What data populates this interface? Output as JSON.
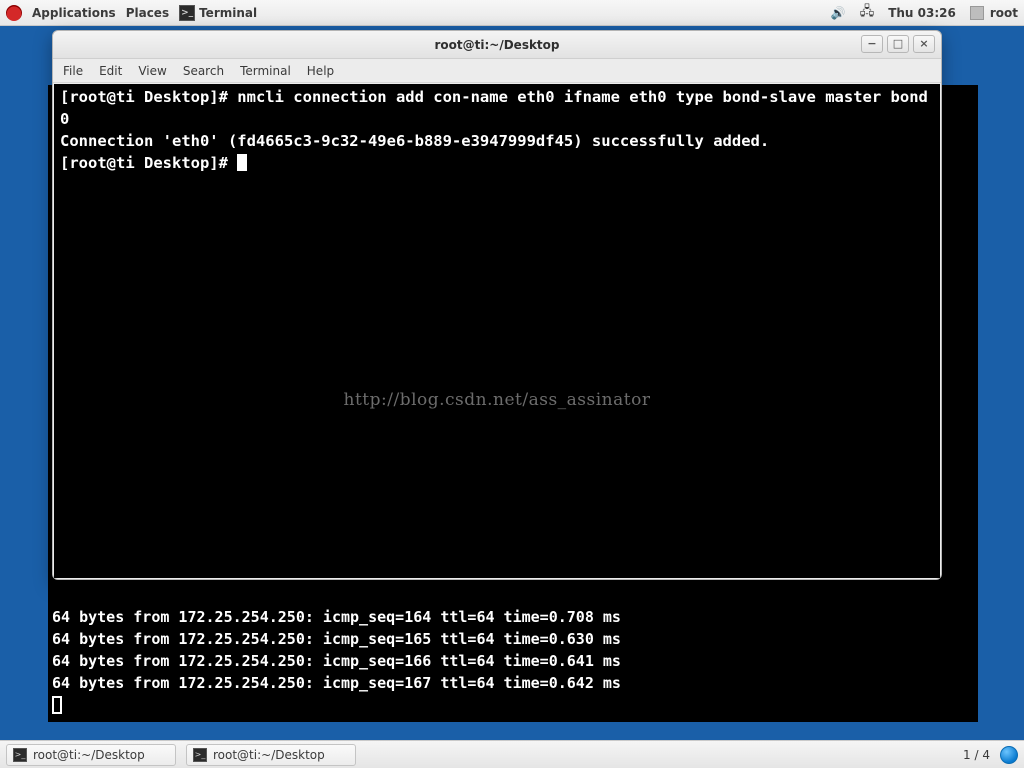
{
  "top_panel": {
    "applications": "Applications",
    "places": "Places",
    "active_app": "Terminal",
    "clock": "Thu 03:26",
    "user": "root"
  },
  "bg_terminal": {
    "ping_lines": [
      "64 bytes from 172.25.254.250: icmp_seq=164 ttl=64 time=0.708 ms",
      "64 bytes from 172.25.254.250: icmp_seq=165 ttl=64 time=0.630 ms",
      "64 bytes from 172.25.254.250: icmp_seq=166 ttl=64 time=0.641 ms",
      "64 bytes from 172.25.254.250: icmp_seq=167 ttl=64 time=0.642 ms"
    ]
  },
  "window": {
    "title": "root@ti:~/Desktop",
    "menu": {
      "file": "File",
      "edit": "Edit",
      "view": "View",
      "search": "Search",
      "terminal": "Terminal",
      "help": "Help"
    },
    "lines": {
      "l1": "[root@ti Desktop]# nmcli connection add con-name eth0 ifname eth0 type bond-slave master bond0",
      "l2": "Connection 'eth0' (fd4665c3-9c32-49e6-b889-e3947999df45) successfully added.",
      "l3": "[root@ti Desktop]# "
    },
    "watermark": "http://blog.csdn.net/ass_assinator"
  },
  "taskbar": {
    "tasks": [
      "root@ti:~/Desktop",
      "root@ti:~/Desktop"
    ],
    "workspace": "1 / 4"
  }
}
